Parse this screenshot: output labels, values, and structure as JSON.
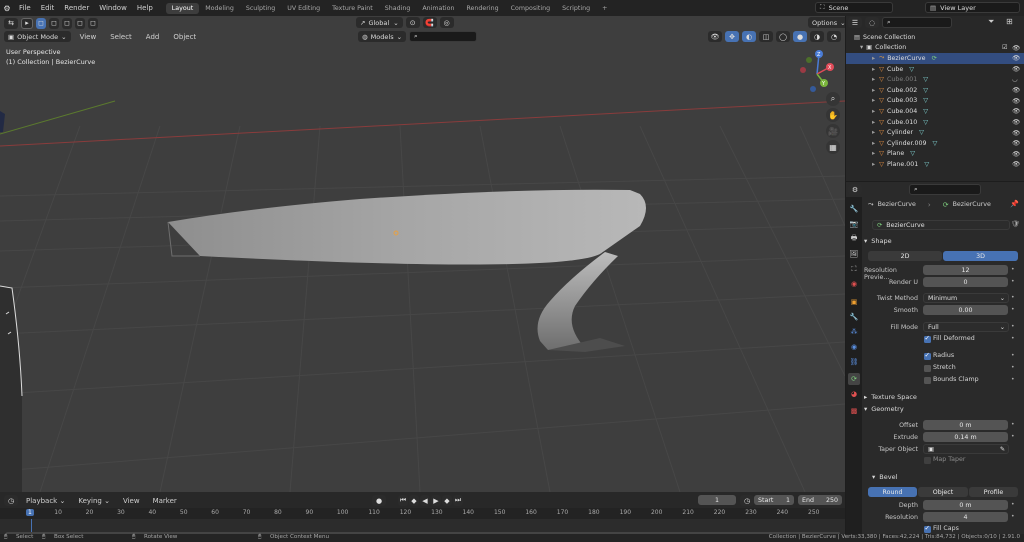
{
  "topbar": {
    "menus": [
      "File",
      "Edit",
      "Render",
      "Window",
      "Help"
    ],
    "workspaces": [
      "Layout",
      "Modeling",
      "Sculpting",
      "UV Editing",
      "Texture Paint",
      "Shading",
      "Animation",
      "Rendering",
      "Compositing",
      "Scripting"
    ],
    "active_workspace": "Layout",
    "add_workspace": "+",
    "scene": "Scene",
    "view_layer": "View Layer"
  },
  "viewport": {
    "mode": "Object Mode",
    "menus": [
      "View",
      "Select",
      "Add",
      "Object"
    ],
    "transform_orientation": "Global",
    "collection_filter": "Models",
    "options_label": "Options",
    "overlay_line1": "User Perspective",
    "overlay_line2": "(1) Collection | BezierCurve",
    "gizmo": {
      "x": "X",
      "y": "Y",
      "z": "Z"
    }
  },
  "outliner": {
    "root": "Scene Collection",
    "collection": "Collection",
    "items": [
      {
        "name": "BezierCurve",
        "dim": false
      },
      {
        "name": "Cube",
        "dim": false
      },
      {
        "name": "Cube.001",
        "dim": true
      },
      {
        "name": "Cube.002",
        "dim": false
      },
      {
        "name": "Cube.003",
        "dim": false
      },
      {
        "name": "Cube.004",
        "dim": false
      },
      {
        "name": "Cube.010",
        "dim": false
      },
      {
        "name": "Cylinder",
        "dim": false
      },
      {
        "name": "Cylinder.009",
        "dim": false
      },
      {
        "name": "Plane",
        "dim": false
      },
      {
        "name": "Plane.001",
        "dim": false
      }
    ]
  },
  "properties": {
    "object_name": "BezierCurve",
    "data_name": "BezierCurve",
    "datablock": "BezierCurve",
    "shape": {
      "title": "Shape",
      "dim_2d": "2D",
      "dim_3d": "3D",
      "resolution_preview_label": "Resolution Previe...",
      "resolution_preview": "12",
      "render_u_label": "Render U",
      "render_u": "0",
      "twist_method_label": "Twist Method",
      "twist_method": "Minimum",
      "smooth_label": "Smooth",
      "smooth": "0.00",
      "fill_mode_label": "Fill Mode",
      "fill_mode": "Full",
      "fill_deformed": "Fill Deformed",
      "radius": "Radius",
      "stretch": "Stretch",
      "bounds_clamp": "Bounds Clamp"
    },
    "texture_space": "Texture Space",
    "geometry": {
      "title": "Geometry",
      "offset_label": "Offset",
      "offset": "0 m",
      "extrude_label": "Extrude",
      "extrude": "0.14 m",
      "taper_label": "Taper Object",
      "map_taper": "Map Taper"
    },
    "bevel": {
      "title": "Bevel",
      "tabs": [
        "Round",
        "Object",
        "Profile"
      ],
      "depth_label": "Depth",
      "depth": "0 m",
      "resolution_label": "Resolution",
      "resolution": "4",
      "fill_caps": "Fill Caps"
    }
  },
  "timeline": {
    "menus": [
      "Playback",
      "Keying",
      "View",
      "Marker"
    ],
    "current_frame": "1",
    "start_label": "Start",
    "start": "1",
    "end_label": "End",
    "end": "250",
    "ruler": [
      "1",
      "10",
      "20",
      "30",
      "40",
      "50",
      "60",
      "70",
      "80",
      "90",
      "100",
      "110",
      "120",
      "130",
      "140",
      "150",
      "160",
      "170",
      "180",
      "190",
      "200",
      "210",
      "220",
      "230",
      "240",
      "250"
    ]
  },
  "statusbar": {
    "select": "Select",
    "box_select": "Box Select",
    "rotate_view": "Rotate View",
    "context_menu": "Object Context Menu",
    "stats": "Collection | BezierCurve | Verts:33,380 | Faces:42,224 | Tris:84,732 | Objects:0/10 | 2.91.0"
  },
  "colors": {
    "accent": "#4772b3",
    "viewport_bg": "#3e3e3e",
    "panel_bg": "#2a2a2a"
  }
}
